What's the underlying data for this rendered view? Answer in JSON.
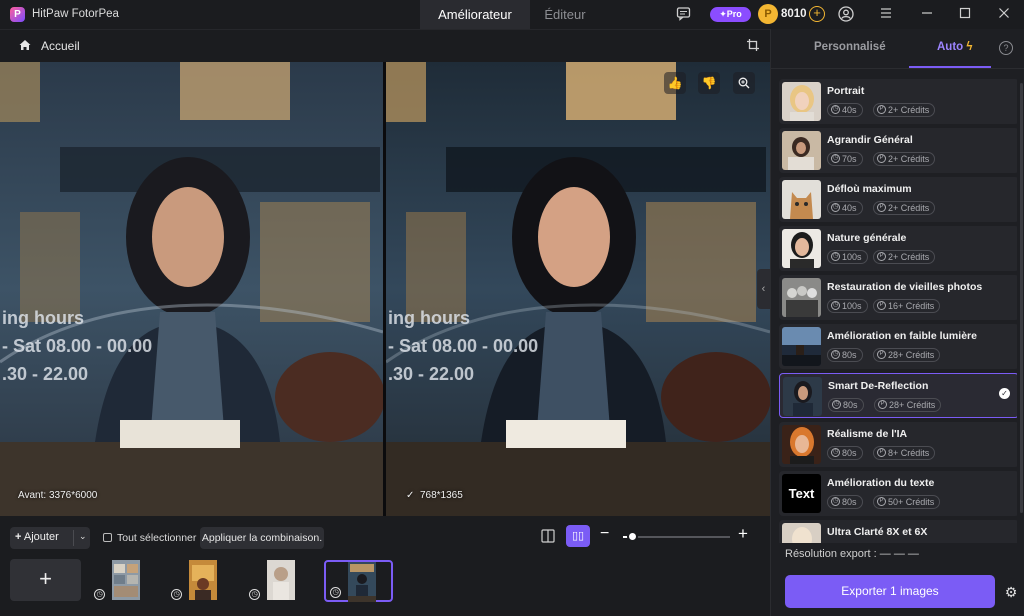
{
  "app": {
    "title": "HitPaw FotorPea",
    "logo_letter": "P"
  },
  "titlebar": {
    "tabs": [
      {
        "label": "Améliorateur",
        "active": true
      },
      {
        "label": "Éditeur",
        "active": false
      }
    ],
    "pro_label": "✦Pro",
    "credits": "8010",
    "icons": [
      "chat-icon",
      "coin-icon",
      "add-credits-icon",
      "user-icon",
      "menu-icon",
      "minimize-icon",
      "maximize-icon",
      "close-icon"
    ]
  },
  "breadcrumb": {
    "home_label": "Accueil"
  },
  "preview": {
    "before_label": "Avant: 3376*6000",
    "after_label": "768*1365",
    "after_check": "✓"
  },
  "toolbar": {
    "add_label": "Ajouter",
    "select_all_label": "Tout sélectionner",
    "apply_label": "Appliquer la combinaison.",
    "zoom_level": 0.08
  },
  "thumbnails": [
    {
      "selected": false
    },
    {
      "selected": false
    },
    {
      "selected": false
    },
    {
      "selected": true
    }
  ],
  "panel": {
    "tabs": [
      {
        "label": "Personnalisé",
        "active": false
      },
      {
        "label": "Auto",
        "active": true
      }
    ],
    "models": [
      {
        "name": "Portrait",
        "time": "40s",
        "cost": "2+ Crédits",
        "selected": false
      },
      {
        "name": "Agrandir Général",
        "time": "70s",
        "cost": "2+ Crédits",
        "selected": false
      },
      {
        "name": "Défloù maximum",
        "time": "40s",
        "cost": "2+ Crédits",
        "selected": false
      },
      {
        "name": "Nature générale",
        "time": "100s",
        "cost": "2+ Crédits",
        "selected": false
      },
      {
        "name": "Restauration de vieilles photos",
        "time": "100s",
        "cost": "16+ Crédits",
        "selected": false
      },
      {
        "name": "Amélioration en faible lumière",
        "time": "80s",
        "cost": "28+ Crédits",
        "selected": false
      },
      {
        "name": "Smart De-Reflection",
        "time": "80s",
        "cost": "28+ Crédits",
        "selected": true
      },
      {
        "name": "Réalisme de l'IA",
        "time": "80s",
        "cost": "8+ Crédits",
        "selected": false
      },
      {
        "name": "Amélioration du texte",
        "time": "80s",
        "cost": "50+ Crédits",
        "selected": false
      },
      {
        "name": "Ultra Clarté 8X et 6X",
        "time": "",
        "cost": "",
        "selected": false
      }
    ],
    "text_thumb_label": "Text",
    "export_resolution_label": "Résolution export : — — —",
    "export_button_label": "Exporter 1 images"
  },
  "colors": {
    "accent": "#7b5cf5",
    "pro": "#8b4dff",
    "coin": "#f3b632"
  }
}
